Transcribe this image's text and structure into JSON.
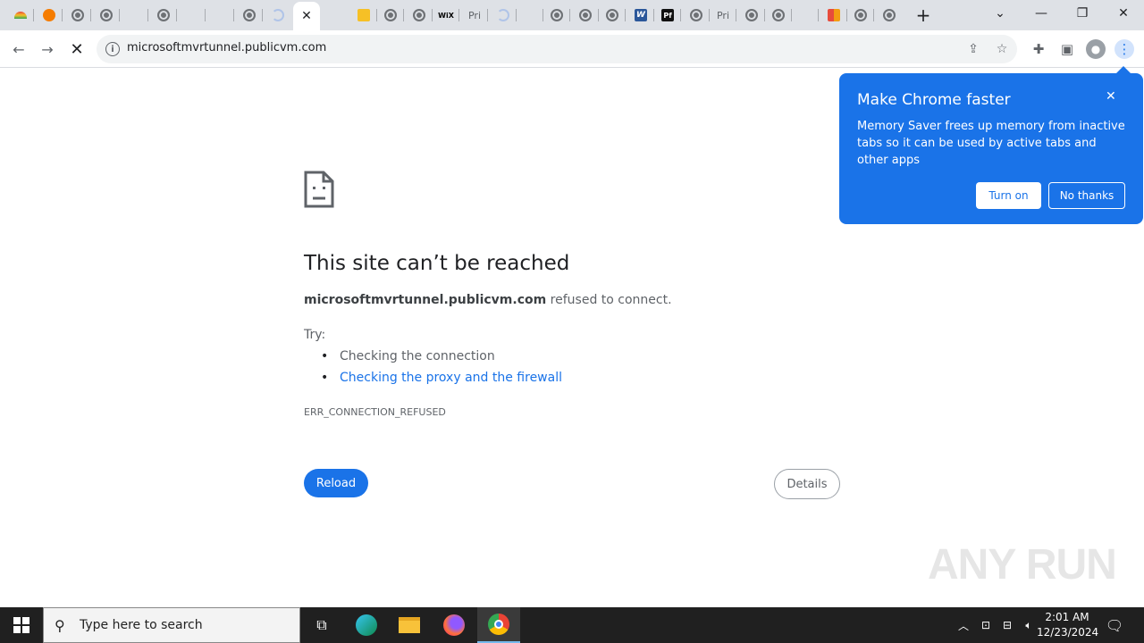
{
  "tabs": [
    {
      "icon": "rainbow-icon",
      "text": "",
      "color": "#e8453c"
    },
    {
      "icon": "orange-circle-icon",
      "text": "",
      "color": "#f57c00"
    },
    {
      "icon": "globe-icon",
      "text": ""
    },
    {
      "icon": "globe-icon",
      "text": ""
    },
    {
      "icon": "blank-icon",
      "text": ""
    },
    {
      "icon": "globe-icon",
      "text": ""
    },
    {
      "icon": "blank-icon",
      "text": ""
    },
    {
      "icon": "blank-icon",
      "text": ""
    },
    {
      "icon": "globe-icon",
      "text": ""
    },
    {
      "icon": "loading-icon",
      "text": ""
    },
    {
      "icon": "close-icon",
      "text": ""
    },
    {
      "icon": "blank-icon",
      "text": ""
    },
    {
      "icon": "note-icon",
      "text": "",
      "color": "#f6c026"
    },
    {
      "icon": "globe-icon",
      "text": ""
    },
    {
      "icon": "globe-icon",
      "text": ""
    },
    {
      "icon": "wix-icon",
      "text": "WiX"
    },
    {
      "icon": "text-icon",
      "text": "Pri"
    },
    {
      "icon": "loading-icon",
      "text": ""
    },
    {
      "icon": "blank-icon",
      "text": ""
    },
    {
      "icon": "globe-icon",
      "text": ""
    },
    {
      "icon": "globe-icon",
      "text": ""
    },
    {
      "icon": "globe-icon",
      "text": ""
    },
    {
      "icon": "word-icon",
      "text": "W",
      "color": "#2b579a"
    },
    {
      "icon": "pdf-icon",
      "text": "Pf",
      "color": "#111111"
    },
    {
      "icon": "globe-icon",
      "text": ""
    },
    {
      "icon": "text-icon",
      "text": "Pri"
    },
    {
      "icon": "globe-icon",
      "text": ""
    },
    {
      "icon": "globe-icon",
      "text": ""
    },
    {
      "icon": "blank-icon",
      "text": ""
    },
    {
      "icon": "office-icon",
      "text": "",
      "color": "#e74c3c"
    },
    {
      "icon": "globe-icon",
      "text": ""
    },
    {
      "icon": "globe-icon",
      "text": ""
    }
  ],
  "toolbar": {
    "url": "microsoftmvrtunnel.publicvm.com"
  },
  "error": {
    "title": "This site can’t be reached",
    "host": "microsoftmvrtunnel.publicvm.com",
    "message": " refused to connect.",
    "try_label": "Try:",
    "suggestion_1": "Checking the connection",
    "suggestion_2": "Checking the proxy and the firewall",
    "code": "ERR_CONNECTION_REFUSED",
    "reload_label": "Reload",
    "details_label": "Details"
  },
  "bubble": {
    "title": "Make Chrome faster",
    "body": "Memory Saver frees up memory from inactive tabs so it can be used by active tabs and other apps",
    "turn_on_label": "Turn on",
    "no_thanks_label": "No thanks"
  },
  "watermark": "ANY RUN",
  "taskbar": {
    "search_placeholder": "Type here to search",
    "time": "2:01 AM",
    "date": "12/23/2024"
  },
  "colors": {
    "accent": "#1a73e8",
    "tabstrip": "#dee1e6",
    "taskbar": "#202020"
  }
}
